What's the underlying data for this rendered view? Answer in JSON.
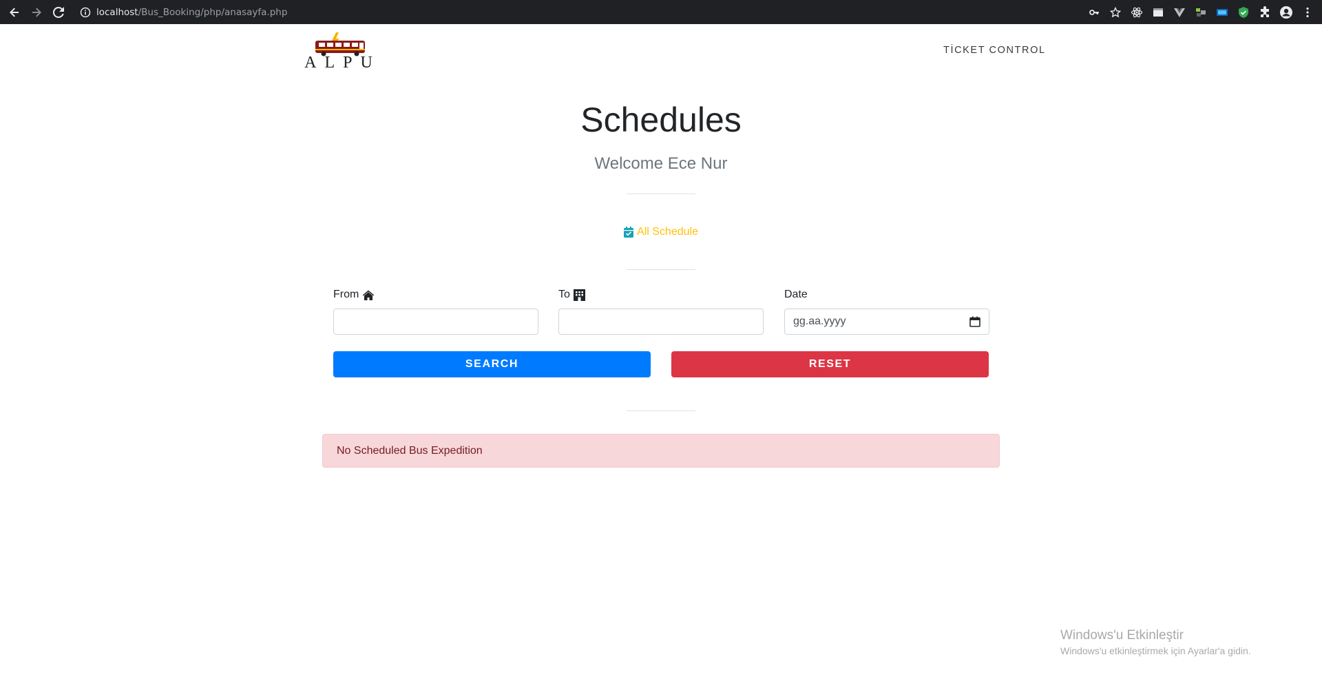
{
  "browser": {
    "url_host": "localhost",
    "url_path": "/Bus_Booking/php/anasayfa.php"
  },
  "navbar": {
    "logo_text": "ALPU",
    "ticket_control": "TİCKET CONTROL"
  },
  "hero": {
    "title": "Schedules",
    "welcome": "Welcome Ece Nur",
    "all_schedule": "All Schedule"
  },
  "form": {
    "from_label": "From",
    "to_label": "To",
    "date_label": "Date",
    "from_value": "",
    "to_value": "",
    "date_placeholder": "gg.aa.yyyy",
    "search_label": "SEARCH",
    "reset_label": "RESET"
  },
  "alert": {
    "message": "No Scheduled Bus Expedition"
  },
  "watermark": {
    "title": "Windows'u Etkinleştir",
    "subtitle": "Windows'u etkinleştirmek için Ayarlar'a gidin."
  },
  "colors": {
    "primary": "#007bff",
    "danger": "#dc3545",
    "warning": "#ffc107",
    "info": "#17a2b8",
    "alert_bg": "#f8d7da",
    "alert_text": "#721c24"
  },
  "icons": {
    "back": "arrow-left-icon",
    "forward": "arrow-right-icon",
    "reload": "reload-icon",
    "site_info": "info-icon",
    "from": "home-icon",
    "to": "building-icon",
    "date": "calendar-icon",
    "all_schedule": "calendar-check-icon"
  }
}
